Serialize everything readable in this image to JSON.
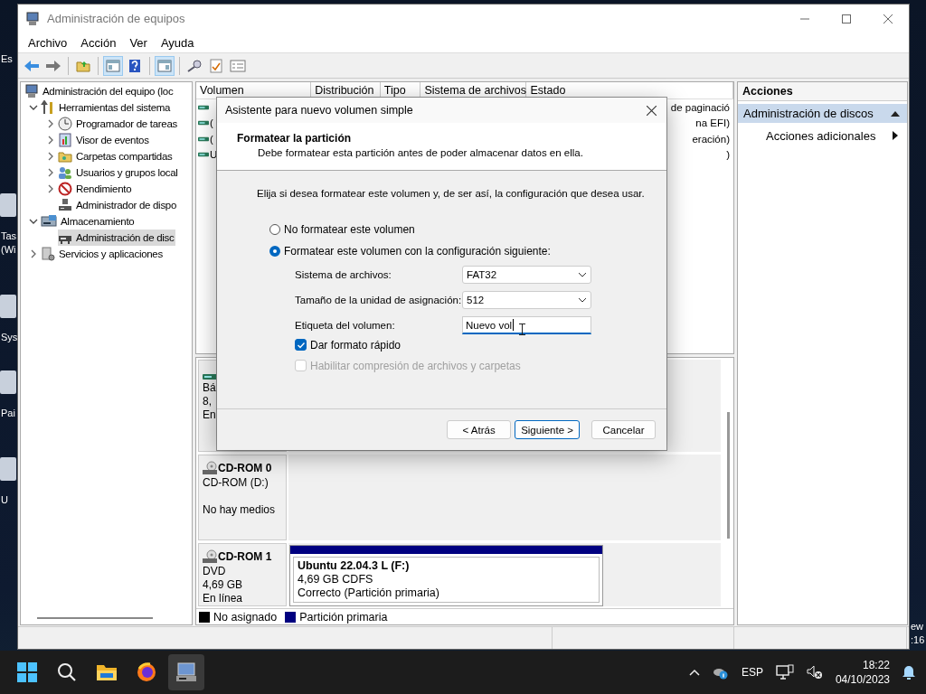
{
  "desktop": {
    "left_labels": [
      {
        "lines": [
          "Es"
        ]
      },
      {
        "lines": [
          "Tas",
          "(Wi"
        ]
      },
      {
        "lines": [
          "Sys"
        ]
      },
      {
        "lines": [
          "Pai"
        ]
      },
      {
        "lines": [
          "U"
        ]
      }
    ],
    "right_labels": [
      "ew",
      ":16"
    ]
  },
  "window": {
    "title": "Administración de equipos",
    "menu": [
      "Archivo",
      "Acción",
      "Ver",
      "Ayuda"
    ],
    "toolbar": [
      {
        "on": false
      },
      {
        "on": false
      },
      {
        "on": false
      },
      {
        "on": true
      },
      {
        "on": false
      },
      {
        "on": true
      },
      {
        "on": false
      },
      {
        "on": false
      },
      {
        "on": false
      }
    ]
  },
  "tree": [
    {
      "label": "Administración del equipo (loc",
      "selected": false,
      "children": [
        {
          "label": "Herramientas del sistema",
          "expanded": true,
          "selected": false,
          "children": [
            {
              "label": "Programador de tareas",
              "expanded": false,
              "selected": false
            },
            {
              "label": "Visor de eventos",
              "expanded": false,
              "selected": false
            },
            {
              "label": "Carpetas compartidas",
              "expanded": false,
              "selected": false
            },
            {
              "label": "Usuarios y grupos local",
              "expanded": false,
              "selected": false
            },
            {
              "label": "Rendimiento",
              "expanded": false,
              "selected": false
            },
            {
              "label": "Administrador de dispo",
              "selected": false
            }
          ]
        },
        {
          "label": "Almacenamiento",
          "expanded": true,
          "selected": false,
          "children": [
            {
              "label": "Administración de disc",
              "selected": true
            }
          ]
        },
        {
          "label": "Servicios y aplicaciones",
          "expanded": false,
          "selected": false
        }
      ]
    }
  ],
  "volume_list": {
    "columns": [
      "Volumen",
      "Distribución",
      "Tipo",
      "Sistema de archivos",
      "Estado"
    ],
    "rows": [
      {
        "state": "de paginació"
      },
      {
        "volume": "(",
        "state": "na EFI)"
      },
      {
        "volume": "(",
        "state": "eración)"
      },
      {
        "volume": "U",
        "state": ")"
      }
    ]
  },
  "disks": [
    {
      "kind": "hdd",
      "type": "Bá",
      "size": "8,",
      "status": "En"
    },
    {
      "kind": "optical",
      "name": "CD-ROM 0",
      "type": "CD-ROM (D:)",
      "status": "No hay medios"
    },
    {
      "kind": "optical",
      "name": "CD-ROM 1",
      "type": "DVD",
      "size": "4,69 GB",
      "status": "En línea",
      "partitions": [
        {
          "label": "Ubuntu 22.04.3 L  (F:)",
          "size": "4,69 GB CDFS",
          "status": "Correcto (Partición primaria)",
          "color": "#000080"
        }
      ]
    }
  ],
  "legend": [
    {
      "label": "No asignado",
      "color": "#000000"
    },
    {
      "label": "Partición primaria",
      "color": "#000080"
    }
  ],
  "actions": {
    "title": "Acciones",
    "items": [
      {
        "kind": "section",
        "label": "Administración de discos",
        "expanded": true
      },
      {
        "kind": "submenu",
        "label": "Acciones adicionales"
      }
    ]
  },
  "dialog": {
    "title": "Asistente para nuevo volumen simple",
    "heading": "Formatear la partición",
    "subtitle": "Debe formatear esta partición antes de poder almacenar datos en ella.",
    "instructions": "Elija si desea formatear este volumen y, de ser así, la configuración que desea usar.",
    "radios": [
      {
        "label": "No formatear este volumen",
        "selected": false
      },
      {
        "label": "Formatear este volumen con la configuración siguiente:",
        "selected": true
      }
    ],
    "fields": [
      {
        "kind": "dropdown",
        "label": "Sistema de archivos:",
        "value": "FAT32"
      },
      {
        "kind": "dropdown",
        "label": "Tamaño de la unidad de asignación:",
        "value": "512"
      },
      {
        "kind": "text",
        "label": "Etiqueta del volumen:",
        "value": "Nuevo vol",
        "focused": true
      }
    ],
    "checkboxes": [
      {
        "label": "Dar formato rápido",
        "checked": true,
        "disabled": false
      },
      {
        "label": "Habilitar compresión de archivos y carpetas",
        "checked": false,
        "disabled": true
      }
    ],
    "buttons": [
      {
        "label": "< Atrás",
        "default": false
      },
      {
        "label": "Siguiente >",
        "default": true
      },
      {
        "label": "Cancelar",
        "default": false
      }
    ]
  },
  "taskbar": {
    "apps": [
      {
        "active": false
      },
      {
        "active": false
      },
      {
        "active": false
      },
      {
        "active": false
      },
      {
        "active": true
      }
    ],
    "language": "ESP",
    "time": "18:22",
    "date": "04/10/2023"
  }
}
